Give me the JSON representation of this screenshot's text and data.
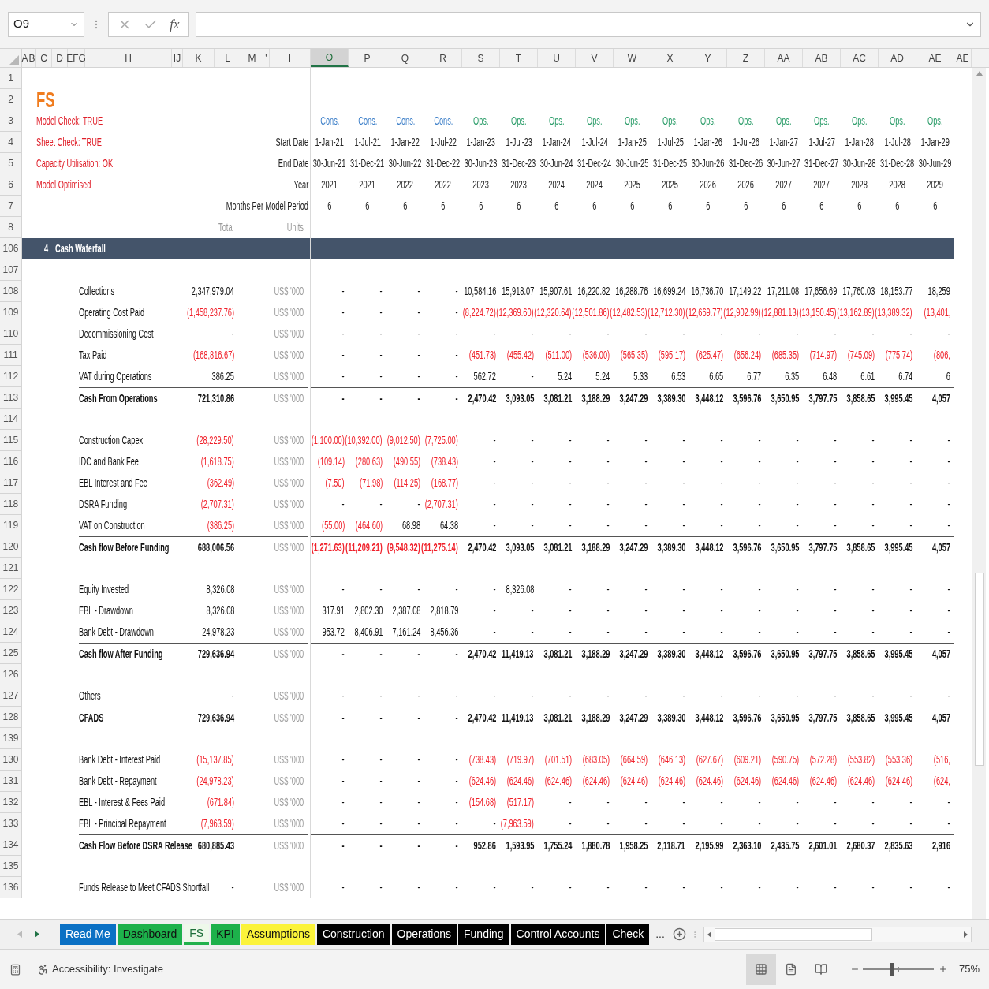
{
  "formula_bar": {
    "name_box": "O9",
    "function_label": "fx"
  },
  "columns": [
    {
      "label": "A",
      "selected": false
    },
    {
      "label": "B",
      "selected": false
    },
    {
      "label": "C",
      "selected": false
    },
    {
      "label": "D",
      "selected": false
    },
    {
      "label": "EFG",
      "selected": false
    },
    {
      "label": "H",
      "selected": false
    },
    {
      "label": "IJ",
      "selected": false
    },
    {
      "label": "K",
      "selected": false
    },
    {
      "label": "L",
      "selected": false
    },
    {
      "label": "M",
      "selected": false
    },
    {
      "label": "'",
      "selected": false
    },
    {
      "label": "I",
      "selected": false
    },
    {
      "label": "O",
      "selected": true
    },
    {
      "label": "P",
      "selected": false
    },
    {
      "label": "Q",
      "selected": false
    },
    {
      "label": "R",
      "selected": false
    },
    {
      "label": "S",
      "selected": false
    },
    {
      "label": "T",
      "selected": false
    },
    {
      "label": "U",
      "selected": false
    },
    {
      "label": "V",
      "selected": false
    },
    {
      "label": "W",
      "selected": false
    },
    {
      "label": "X",
      "selected": false
    },
    {
      "label": "Y",
      "selected": false
    },
    {
      "label": "Z",
      "selected": false
    },
    {
      "label": "AA",
      "selected": false
    },
    {
      "label": "AB",
      "selected": false
    },
    {
      "label": "AC",
      "selected": false
    },
    {
      "label": "AD",
      "selected": false
    },
    {
      "label": "AE",
      "selected": false
    },
    {
      "label": "AE",
      "selected": false
    }
  ],
  "rows": [
    {
      "num": "1",
      "kind": "blank"
    },
    {
      "num": "2",
      "kind": "title",
      "title": "FS"
    },
    {
      "num": "3",
      "kind": "phase",
      "note": "Model Check: TRUE",
      "phases": [
        {
          "label": "Cons.",
          "color": "#3b7ec8"
        },
        {
          "label": "Cons.",
          "color": "#3b7ec8"
        },
        {
          "label": "Cons.",
          "color": "#3b7ec8"
        },
        {
          "label": "Cons.",
          "color": "#3b7ec8"
        },
        {
          "label": "Ops.",
          "color": "#2e9e6b"
        },
        {
          "label": "Ops.",
          "color": "#2e9e6b"
        },
        {
          "label": "Ops.",
          "color": "#2e9e6b"
        },
        {
          "label": "Ops.",
          "color": "#2e9e6b"
        },
        {
          "label": "Ops.",
          "color": "#2e9e6b"
        },
        {
          "label": "Ops.",
          "color": "#2e9e6b"
        },
        {
          "label": "Ops.",
          "color": "#2e9e6b"
        },
        {
          "label": "Ops.",
          "color": "#2e9e6b"
        },
        {
          "label": "Ops.",
          "color": "#2e9e6b"
        },
        {
          "label": "Ops.",
          "color": "#2e9e6b"
        },
        {
          "label": "Ops.",
          "color": "#2e9e6b"
        },
        {
          "label": "Ops.",
          "color": "#2e9e6b"
        },
        {
          "label": "Ops.",
          "color": "#2e9e6b"
        }
      ]
    },
    {
      "num": "4",
      "kind": "header",
      "note": "Sheet Check: TRUE",
      "label": "Start Date",
      "values": [
        "1-Jan-21",
        "1-Jul-21",
        "1-Jan-22",
        "1-Jul-22",
        "1-Jan-23",
        "1-Jul-23",
        "1-Jan-24",
        "1-Jul-24",
        "1-Jan-25",
        "1-Jul-25",
        "1-Jan-26",
        "1-Jul-26",
        "1-Jan-27",
        "1-Jul-27",
        "1-Jan-28",
        "1-Jul-28",
        "1-Jan-29"
      ]
    },
    {
      "num": "5",
      "kind": "header",
      "note": "Capacity Utilisation: OK",
      "label": "End Date",
      "values": [
        "30-Jun-21",
        "31-Dec-21",
        "30-Jun-22",
        "31-Dec-22",
        "30-Jun-23",
        "31-Dec-23",
        "30-Jun-24",
        "31-Dec-24",
        "30-Jun-25",
        "31-Dec-25",
        "30-Jun-26",
        "31-Dec-26",
        "30-Jun-27",
        "31-Dec-27",
        "30-Jun-28",
        "31-Dec-28",
        "30-Jun-29"
      ]
    },
    {
      "num": "6",
      "kind": "header",
      "note": "Model Optimised",
      "label": "Year",
      "values": [
        "2021",
        "2021",
        "2022",
        "2022",
        "2023",
        "2023",
        "2024",
        "2024",
        "2025",
        "2025",
        "2026",
        "2026",
        "2027",
        "2027",
        "2028",
        "2028",
        "2029"
      ]
    },
    {
      "num": "7",
      "kind": "header",
      "label": "Months Per Model Period",
      "values": [
        "6",
        "6",
        "6",
        "6",
        "6",
        "6",
        "6",
        "6",
        "6",
        "6",
        "6",
        "6",
        "6",
        "6",
        "6",
        "6",
        "6"
      ]
    },
    {
      "num": "8",
      "kind": "units_header",
      "total": "Total",
      "units": "Units"
    },
    {
      "num": "106",
      "kind": "section",
      "number": "4",
      "label": "Cash Waterfall"
    },
    {
      "num": "107",
      "kind": "blank"
    },
    {
      "num": "108",
      "kind": "item",
      "label": "Collections",
      "total": "2,347,979.04",
      "units": "US$ '000",
      "values": [
        "-",
        "-",
        "-",
        "-",
        "10,584.16",
        "15,918.07",
        "15,907.61",
        "16,220.82",
        "16,288.76",
        "16,699.24",
        "16,736.70",
        "17,149.22",
        "17,211.08",
        "17,656.69",
        "17,760.03",
        "18,153.77",
        "18,259"
      ]
    },
    {
      "num": "109",
      "kind": "item",
      "label": "Operating Cost Paid",
      "total": "(1,458,237.76)",
      "units": "US$ '000",
      "values": [
        "-",
        "-",
        "-",
        "-",
        "(8,224.72)",
        "(12,369.60)",
        "(12,320.64)",
        "(12,501.86)",
        "(12,482.53)",
        "(12,712.30)",
        "(12,669.77)",
        "(12,902.99)",
        "(12,881.13)",
        "(13,150.45)",
        "(13,162.89)",
        "(13,389.32)",
        "(13,401,"
      ]
    },
    {
      "num": "110",
      "kind": "item",
      "label": "Decommissioning Cost",
      "total": "-",
      "units": "US$ '000",
      "values": [
        "-",
        "-",
        "-",
        "-",
        "-",
        "-",
        "-",
        "-",
        "-",
        "-",
        "-",
        "-",
        "-",
        "-",
        "-",
        "-",
        "-"
      ]
    },
    {
      "num": "111",
      "kind": "item",
      "label": "Tax Paid",
      "total": "(168,816.67)",
      "units": "US$ '000",
      "values": [
        "-",
        "-",
        "-",
        "-",
        "(451.73)",
        "(455.42)",
        "(511.00)",
        "(536.00)",
        "(565.35)",
        "(595.17)",
        "(625.47)",
        "(656.24)",
        "(685.35)",
        "(714.97)",
        "(745.09)",
        "(775.74)",
        "(806,"
      ]
    },
    {
      "num": "112",
      "kind": "item",
      "label": "VAT during Operations",
      "total": "386.25",
      "units": "US$ '000",
      "values": [
        "-",
        "-",
        "-",
        "-",
        "562.72",
        "-",
        "5.24",
        "5.24",
        "5.33",
        "6.53",
        "6.65",
        "6.77",
        "6.35",
        "6.48",
        "6.61",
        "6.74",
        "6"
      ]
    },
    {
      "num": "113",
      "kind": "subtotal",
      "label": "Cash From Operations",
      "total": "721,310.86",
      "units": "US$ '000",
      "values": [
        "-",
        "-",
        "-",
        "-",
        "2,470.42",
        "3,093.05",
        "3,081.21",
        "3,188.29",
        "3,247.29",
        "3,389.30",
        "3,448.12",
        "3,596.76",
        "3,650.95",
        "3,797.75",
        "3,858.65",
        "3,995.45",
        "4,057"
      ]
    },
    {
      "num": "114",
      "kind": "blank"
    },
    {
      "num": "115",
      "kind": "item",
      "label": "Construction Capex",
      "total": "(28,229.50)",
      "units": "US$ '000",
      "values": [
        "(1,100.00)",
        "(10,392.00)",
        "(9,012.50)",
        "(7,725.00)",
        "-",
        "-",
        "-",
        "-",
        "-",
        "-",
        "-",
        "-",
        "-",
        "-",
        "-",
        "-",
        "-"
      ]
    },
    {
      "num": "116",
      "kind": "item",
      "label": "IDC and Bank Fee",
      "total": "(1,618.75)",
      "units": "US$ '000",
      "values": [
        "(109.14)",
        "(280.63)",
        "(490.55)",
        "(738.43)",
        "-",
        "-",
        "-",
        "-",
        "-",
        "-",
        "-",
        "-",
        "-",
        "-",
        "-",
        "-",
        "-"
      ]
    },
    {
      "num": "117",
      "kind": "item",
      "label": "EBL Interest and Fee",
      "total": "(362.49)",
      "units": "US$ '000",
      "values": [
        "(7.50)",
        "(71.98)",
        "(114.25)",
        "(168.77)",
        "-",
        "-",
        "-",
        "-",
        "-",
        "-",
        "-",
        "-",
        "-",
        "-",
        "-",
        "-",
        "-"
      ]
    },
    {
      "num": "118",
      "kind": "item",
      "label": "DSRA Funding",
      "total": "(2,707.31)",
      "units": "US$ '000",
      "values": [
        "-",
        "-",
        "-",
        "(2,707.31)",
        "-",
        "-",
        "-",
        "-",
        "-",
        "-",
        "-",
        "-",
        "-",
        "-",
        "-",
        "-",
        "-"
      ]
    },
    {
      "num": "119",
      "kind": "item",
      "label": "VAT on Construction",
      "total": "(386.25)",
      "units": "US$ '000",
      "values": [
        "(55.00)",
        "(464.60)",
        "68.98",
        "64.38",
        "-",
        "-",
        "-",
        "-",
        "-",
        "-",
        "-",
        "-",
        "-",
        "-",
        "-",
        "-",
        "-"
      ]
    },
    {
      "num": "120",
      "kind": "subtotal",
      "label": "Cash flow Before Funding",
      "total": "688,006.56",
      "units": "US$ '000",
      "values": [
        "(1,271.63)",
        "(11,209.21)",
        "(9,548.32)",
        "(11,275.14)",
        "2,470.42",
        "3,093.05",
        "3,081.21",
        "3,188.29",
        "3,247.29",
        "3,389.30",
        "3,448.12",
        "3,596.76",
        "3,650.95",
        "3,797.75",
        "3,858.65",
        "3,995.45",
        "4,057"
      ]
    },
    {
      "num": "121",
      "kind": "blank"
    },
    {
      "num": "122",
      "kind": "item",
      "label": "Equity Invested",
      "total": "8,326.08",
      "units": "US$ '000",
      "values": [
        "-",
        "-",
        "-",
        "-",
        "-",
        "8,326.08",
        "-",
        "-",
        "-",
        "-",
        "-",
        "-",
        "-",
        "-",
        "-",
        "-",
        "-"
      ]
    },
    {
      "num": "123",
      "kind": "item",
      "label": "EBL - Drawdown",
      "total": "8,326.08",
      "units": "US$ '000",
      "values": [
        "317.91",
        "2,802.30",
        "2,387.08",
        "2,818.79",
        "-",
        "-",
        "-",
        "-",
        "-",
        "-",
        "-",
        "-",
        "-",
        "-",
        "-",
        "-",
        "-"
      ]
    },
    {
      "num": "124",
      "kind": "item",
      "label": "Bank Debt - Drawdown",
      "total": "24,978.23",
      "units": "US$ '000",
      "values": [
        "953.72",
        "8,406.91",
        "7,161.24",
        "8,456.36",
        "-",
        "-",
        "-",
        "-",
        "-",
        "-",
        "-",
        "-",
        "-",
        "-",
        "-",
        "-",
        "-"
      ]
    },
    {
      "num": "125",
      "kind": "subtotal",
      "label": "Cash flow After Funding",
      "total": "729,636.94",
      "units": "US$ '000",
      "values": [
        "-",
        "-",
        "-",
        "-",
        "2,470.42",
        "11,419.13",
        "3,081.21",
        "3,188.29",
        "3,247.29",
        "3,389.30",
        "3,448.12",
        "3,596.76",
        "3,650.95",
        "3,797.75",
        "3,858.65",
        "3,995.45",
        "4,057"
      ]
    },
    {
      "num": "126",
      "kind": "blank"
    },
    {
      "num": "127",
      "kind": "item",
      "label": "Others",
      "total": "-",
      "units": "US$ '000",
      "values": [
        "-",
        "-",
        "-",
        "-",
        "-",
        "-",
        "-",
        "-",
        "-",
        "-",
        "-",
        "-",
        "-",
        "-",
        "-",
        "-",
        "-"
      ]
    },
    {
      "num": "128",
      "kind": "subtotal",
      "label": "CFADS",
      "total": "729,636.94",
      "units": "US$ '000",
      "values": [
        "-",
        "-",
        "-",
        "-",
        "2,470.42",
        "11,419.13",
        "3,081.21",
        "3,188.29",
        "3,247.29",
        "3,389.30",
        "3,448.12",
        "3,596.76",
        "3,650.95",
        "3,797.75",
        "3,858.65",
        "3,995.45",
        "4,057"
      ]
    },
    {
      "num": "139",
      "kind": "blank"
    },
    {
      "num": "130",
      "kind": "item",
      "label": "Bank Debt - Interest Paid",
      "total": "(15,137.85)",
      "units": "US$ '000",
      "values": [
        "-",
        "-",
        "-",
        "-",
        "(738.43)",
        "(719.97)",
        "(701.51)",
        "(683.05)",
        "(664.59)",
        "(646.13)",
        "(627.67)",
        "(609.21)",
        "(590.75)",
        "(572.28)",
        "(553.82)",
        "(553.36)",
        "(516,"
      ]
    },
    {
      "num": "131",
      "kind": "item",
      "label": "Bank Debt - Repayment",
      "total": "(24,978.23)",
      "units": "US$ '000",
      "values": [
        "-",
        "-",
        "-",
        "-",
        "(624.46)",
        "(624.46)",
        "(624.46)",
        "(624.46)",
        "(624.46)",
        "(624.46)",
        "(624.46)",
        "(624.46)",
        "(624.46)",
        "(624.46)",
        "(624.46)",
        "(624.46)",
        "(624,"
      ]
    },
    {
      "num": "132",
      "kind": "item",
      "label": "EBL - Interest & Fees Paid",
      "total": "(671.84)",
      "units": "US$ '000",
      "values": [
        "-",
        "-",
        "-",
        "-",
        "(154.68)",
        "(517.17)",
        "-",
        "-",
        "-",
        "-",
        "-",
        "-",
        "-",
        "-",
        "-",
        "-",
        "-"
      ]
    },
    {
      "num": "133",
      "kind": "item",
      "label": "EBL - Principal Repayment",
      "total": "(7,963.59)",
      "units": "US$ '000",
      "values": [
        "-",
        "-",
        "-",
        "-",
        "-",
        "(7,963.59)",
        "-",
        "-",
        "-",
        "-",
        "-",
        "-",
        "-",
        "-",
        "-",
        "-",
        "-"
      ]
    },
    {
      "num": "134",
      "kind": "subtotal",
      "label": "Cash Flow Before DSRA Release",
      "total": "680,885.43",
      "units": "US$ '000",
      "values": [
        "-",
        "-",
        "-",
        "-",
        "952.86",
        "1,593.95",
        "1,755.24",
        "1,880.78",
        "1,958.25",
        "2,118.71",
        "2,195.99",
        "2,363.10",
        "2,435.75",
        "2,601.01",
        "2,680.37",
        "2,835.63",
        "2,916"
      ]
    },
    {
      "num": "135",
      "kind": "blank"
    },
    {
      "num": "136",
      "kind": "item",
      "label": "Funds Release to Meet CFADS Shortfall",
      "total": "-",
      "units": "US$ '000",
      "values": [
        "-",
        "-",
        "-",
        "-",
        "-",
        "-",
        "-",
        "-",
        "-",
        "-",
        "-",
        "-",
        "-",
        "-",
        "-",
        "-",
        "-"
      ]
    }
  ],
  "sheet_tabs": [
    {
      "label": "Read Me",
      "color": "#0a70c4",
      "selected": false
    },
    {
      "label": "Dashboard",
      "color": "#1db14b",
      "selected": false
    },
    {
      "label": "FS",
      "color": "#22b14c",
      "selected": true
    },
    {
      "label": "KPI",
      "color": "#1db14b",
      "selected": false
    },
    {
      "label": "Assumptions",
      "color": "#fbf33a",
      "selected": false
    },
    {
      "label": "Construction",
      "color": "#000000",
      "selected": false
    },
    {
      "label": "Operations",
      "color": "#000000",
      "selected": false
    },
    {
      "label": "Funding",
      "color": "#000000",
      "selected": false
    },
    {
      "label": "Control Accounts",
      "color": "#000000",
      "selected": false
    },
    {
      "label": "Check",
      "color": "#000000",
      "selected": false
    }
  ],
  "more_tabs": "...",
  "status_bar": {
    "accessibility": "Accessibility: Investigate",
    "views": [
      {
        "kind": "normal",
        "selected": true
      },
      {
        "kind": "page_layout",
        "selected": false
      },
      {
        "kind": "page_break",
        "selected": false
      }
    ],
    "zoom_slider": {
      "level": 0.39
    },
    "zoom": "75%"
  }
}
